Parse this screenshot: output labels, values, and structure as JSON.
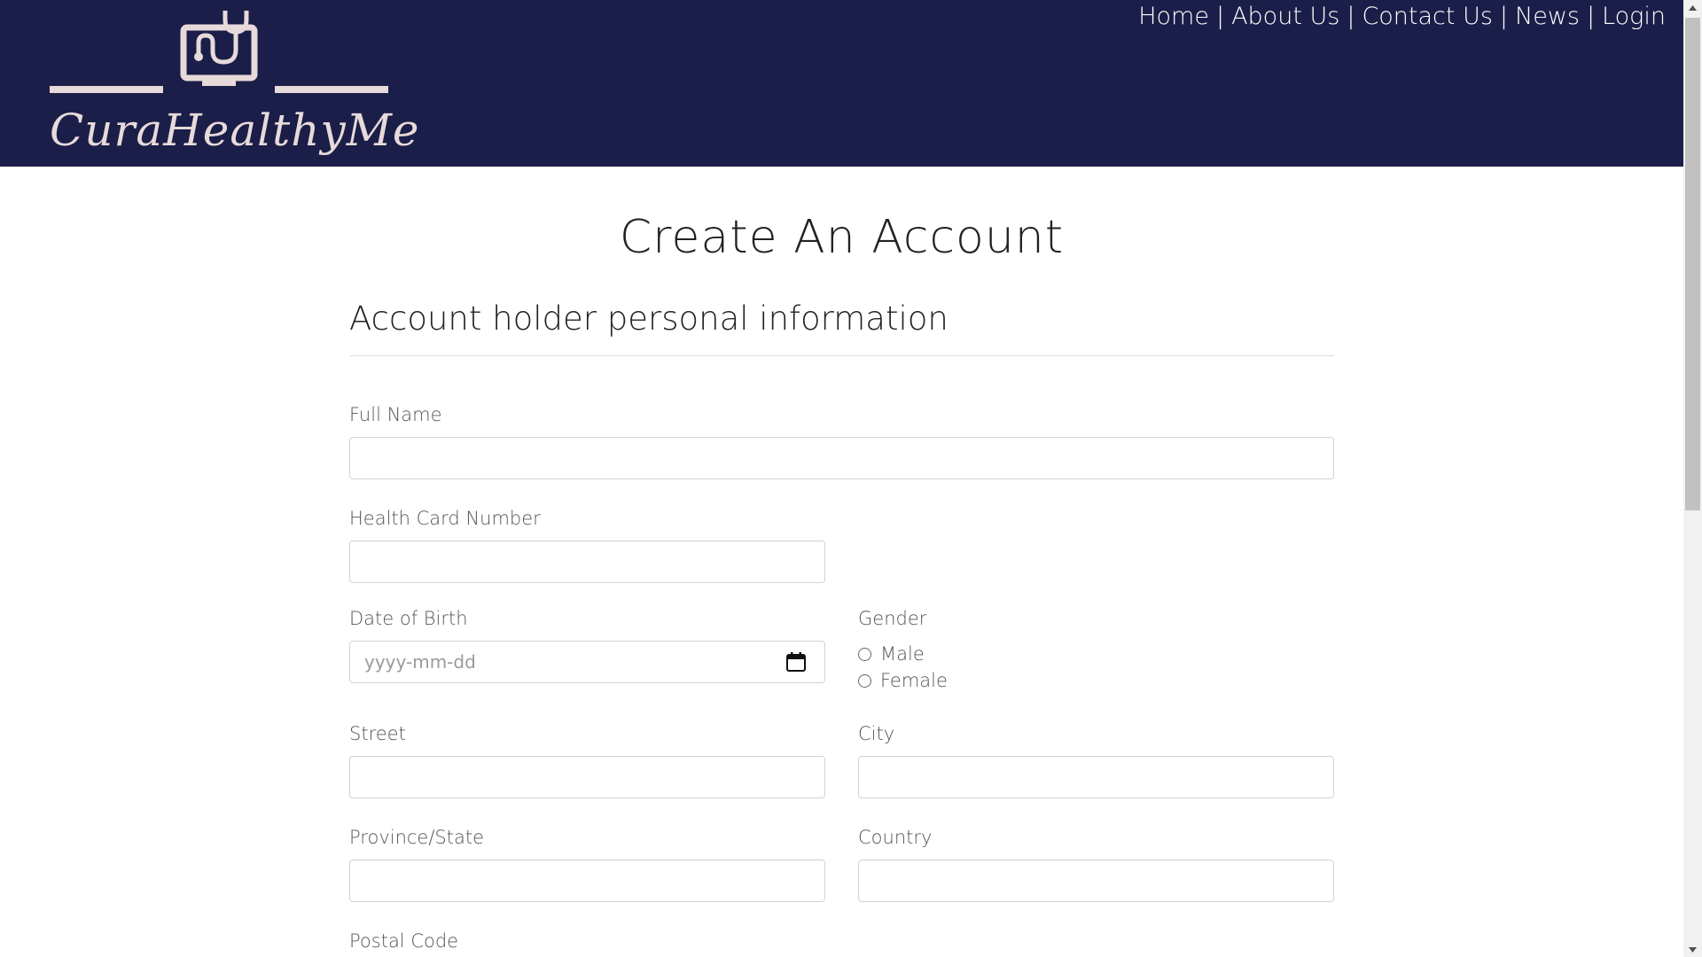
{
  "header": {
    "logo_text": "CuraHealthyMe",
    "nav": [
      {
        "label": "Home"
      },
      {
        "label": "About Us"
      },
      {
        "label": "Contact Us"
      },
      {
        "label": "News"
      },
      {
        "label": "Login"
      }
    ],
    "separator": "|"
  },
  "main": {
    "title": "Create An Account",
    "section_title": "Account holder personal information",
    "fields": {
      "full_name": {
        "label": "Full Name",
        "value": ""
      },
      "health_card": {
        "label": "Health Card Number",
        "value": ""
      },
      "dob": {
        "label": "Date of Birth",
        "placeholder": "yyyy-mm-dd"
      },
      "gender": {
        "label": "Gender",
        "options": [
          "Male",
          "Female"
        ]
      },
      "street": {
        "label": "Street",
        "value": ""
      },
      "city": {
        "label": "City",
        "value": ""
      },
      "province": {
        "label": "Province/State",
        "value": ""
      },
      "country": {
        "label": "Country",
        "value": ""
      },
      "postal": {
        "label": "Postal Code"
      }
    }
  },
  "colors": {
    "header_bg": "#1b1e48",
    "logo": "#e7dada",
    "nav_text": "#ffffff"
  },
  "icons": {
    "logo": "monitor-stethoscope-icon",
    "date": "calendar-icon",
    "scroll_up": "chevron-up-icon",
    "scroll_down": "chevron-down-icon"
  }
}
